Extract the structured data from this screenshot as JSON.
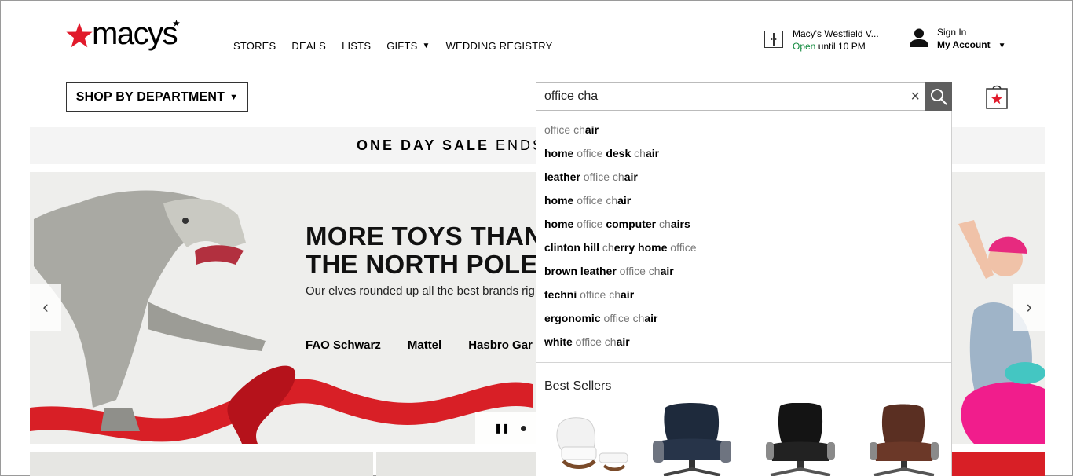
{
  "brand": {
    "name": "macy's",
    "logo_text": "macys",
    "accent_color": "#e11a2b"
  },
  "nav": {
    "items": [
      "STORES",
      "DEALS",
      "LISTS",
      "GIFTS",
      "WEDDING REGISTRY"
    ]
  },
  "store": {
    "name": "Macy's Westfield V...",
    "open_label": "Open",
    "hours_text": "until 10 PM",
    "icon": "store-icon"
  },
  "account": {
    "sign_in": "Sign In",
    "my_account": "My Account",
    "icon": "user-icon"
  },
  "department_button": {
    "label": "SHOP BY DEPARTMENT"
  },
  "search": {
    "value": "office cha",
    "clear_label": "×",
    "icon": "search-icon"
  },
  "bag": {
    "icon": "shopping-bag-icon"
  },
  "sale_bar": {
    "bold_text": "ONE DAY SALE",
    "rest_text": "ENDS"
  },
  "hero": {
    "title_line1": "MORE TOYS THAN",
    "title_line2": "THE NORTH POLE",
    "subtitle": "Our elves rounded up all the best brands rig",
    "brands": [
      "FAO Schwarz",
      "Mattel",
      "Hasbro Gar"
    ],
    "prev_label": "‹",
    "next_label": "›",
    "pause_label": "❚❚"
  },
  "suggestions": [
    [
      [
        "office ch",
        false
      ],
      [
        "air",
        true
      ]
    ],
    [
      [
        "home",
        true
      ],
      [
        " office ",
        false
      ],
      [
        "desk",
        true
      ],
      [
        " ch",
        false
      ],
      [
        "air",
        true
      ]
    ],
    [
      [
        "leather",
        true
      ],
      [
        " office ch",
        false
      ],
      [
        "air",
        true
      ]
    ],
    [
      [
        "home",
        true
      ],
      [
        " office ch",
        false
      ],
      [
        "air",
        true
      ]
    ],
    [
      [
        "home",
        true
      ],
      [
        " office ",
        false
      ],
      [
        "computer",
        true
      ],
      [
        " ch",
        false
      ],
      [
        "airs",
        true
      ]
    ],
    [
      [
        "clinton hill",
        true
      ],
      [
        " ch",
        false
      ],
      [
        "erry home",
        true
      ],
      [
        " office",
        false
      ]
    ],
    [
      [
        "brown leather",
        true
      ],
      [
        " office ch",
        false
      ],
      [
        "air",
        true
      ]
    ],
    [
      [
        "techni",
        true
      ],
      [
        " office ch",
        false
      ],
      [
        "air",
        true
      ]
    ],
    [
      [
        "ergonomic",
        true
      ],
      [
        " office ch",
        false
      ],
      [
        "air",
        true
      ]
    ],
    [
      [
        "white",
        true
      ],
      [
        " office ch",
        false
      ],
      [
        "air",
        true
      ]
    ]
  ],
  "best_sellers": {
    "title": "Best Sellers",
    "products": [
      "white-lounge-chair-image",
      "navy-executive-chair-image",
      "black-leather-chair-image",
      "brown-leather-chair-image"
    ]
  }
}
